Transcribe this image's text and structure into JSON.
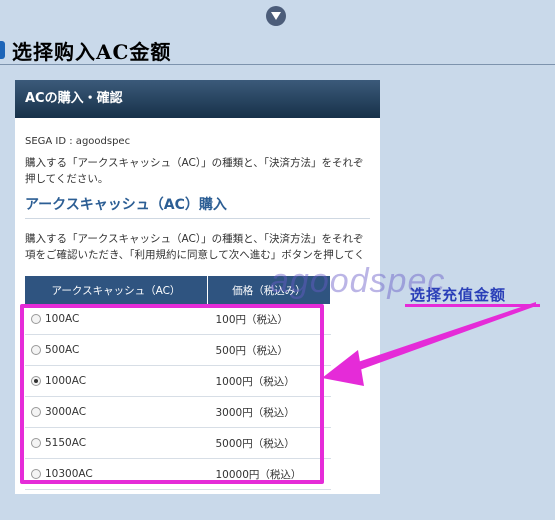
{
  "section_title": "选择购入AC金额",
  "panel": {
    "header": "ACの購入・確認",
    "sega_id": "SEGA ID : agoodspec",
    "desc_line1": "購入する「アークスキャッシュ（AC）」の種類と、「決済方法」をそれぞ",
    "desc_line2": "押してください。",
    "sub_heading": "アークスキャッシュ（AC）購入",
    "desc2_line1": "購入する「アークスキャッシュ（AC）」の種類と、「決済方法」をそれぞ",
    "desc2_line2": "項をご確認いただき、「利用規約に同意して次へ進む」ボタンを押してく"
  },
  "table": {
    "headers": [
      "アークスキャッシュ（AC）",
      "価格（税込み）"
    ],
    "rows": [
      {
        "ac": "100AC",
        "price": "100円（税込）",
        "selected": false
      },
      {
        "ac": "500AC",
        "price": "500円（税込）",
        "selected": false
      },
      {
        "ac": "1000AC",
        "price": "1000円（税込）",
        "selected": true
      },
      {
        "ac": "3000AC",
        "price": "3000円（税込）",
        "selected": false
      },
      {
        "ac": "5150AC",
        "price": "5000円（税込）",
        "selected": false
      },
      {
        "ac": "10300AC",
        "price": "10000円（税込）",
        "selected": false
      }
    ]
  },
  "watermark": "agoodspec",
  "annotation": "选择充值金额",
  "colors": {
    "highlight": "#e52bd8",
    "header_bg": "#2f5480",
    "annotation_text": "#2a3fb8"
  }
}
